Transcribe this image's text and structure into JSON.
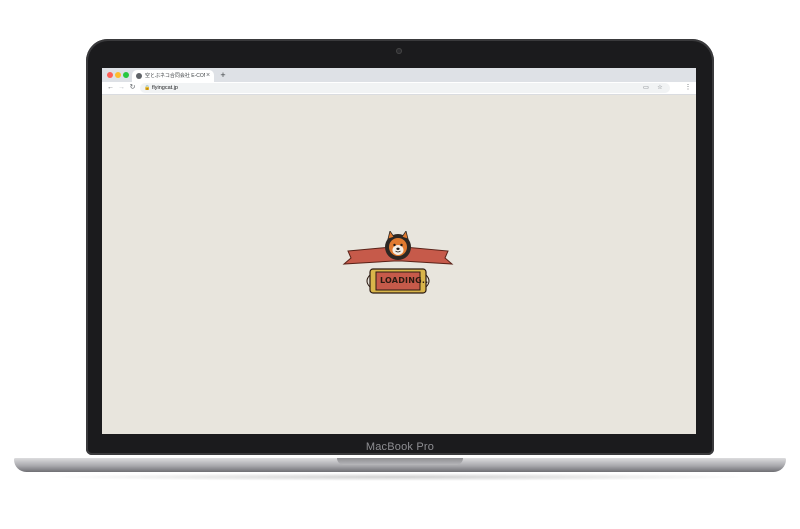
{
  "device": {
    "brand_label": "MacBook Pro"
  },
  "browser": {
    "tab": {
      "title": "空とぶネコ合同会社 E-COMMERCE",
      "close_glyph": "×"
    },
    "new_tab_glyph": "+",
    "address_bar": {
      "url": "flyingcat.jp"
    },
    "nav": {
      "back": "←",
      "forward": "→",
      "reload": "↻"
    },
    "menu_glyph": "⋮",
    "icons": {
      "lock": "lock-icon",
      "bookmark": "bookmark-icon",
      "star": "star-icon",
      "favicon": "globe-icon"
    }
  },
  "page": {
    "loading_label": "LOADING..",
    "colors": {
      "background": "#e8e5dd",
      "ribbon": "#c65a4a",
      "frame": "#d9b54a",
      "plaque": "#c65a4a"
    }
  }
}
